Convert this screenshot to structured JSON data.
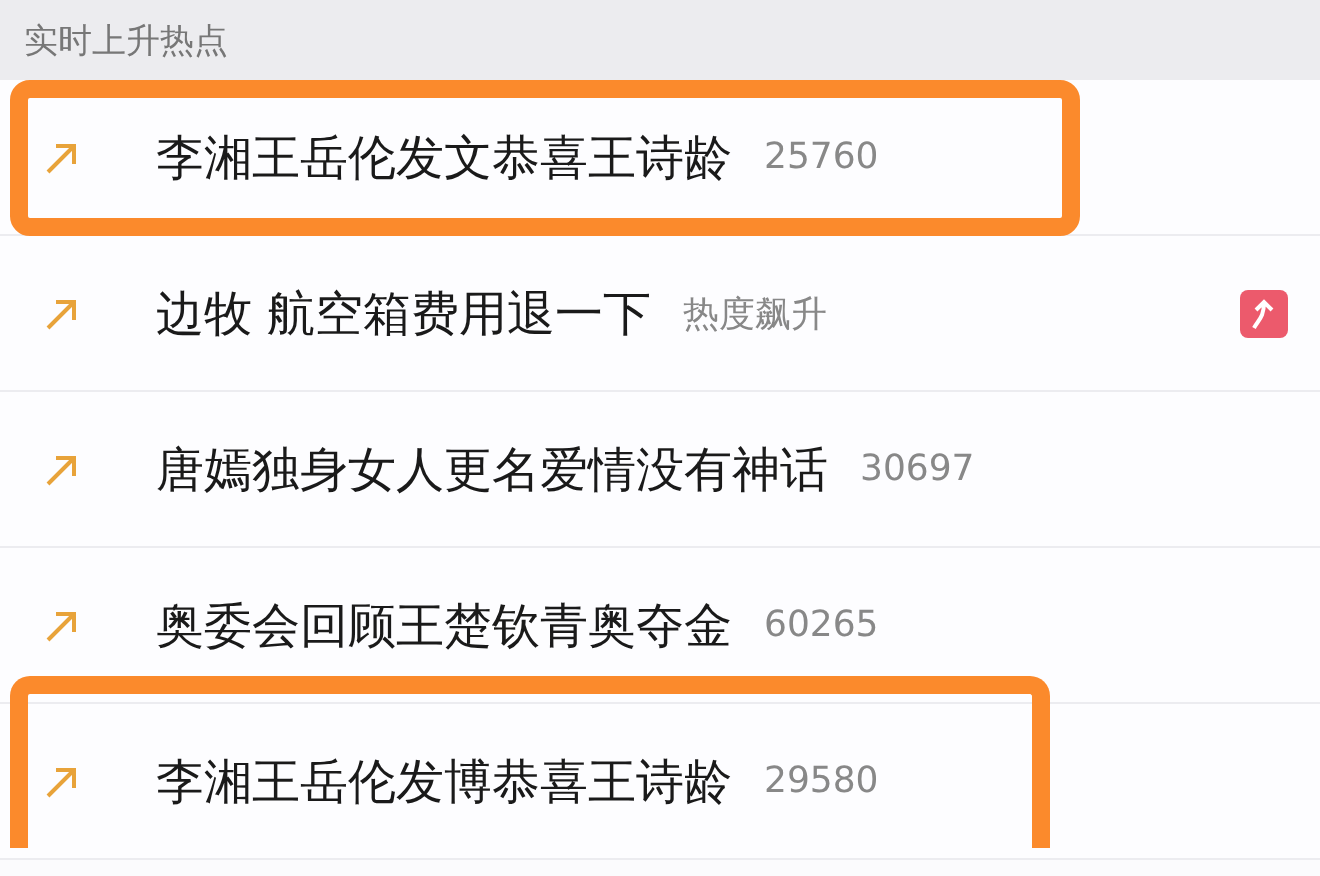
{
  "section_title": "实时上升热点",
  "items": [
    {
      "title": "李湘王岳伦发文恭喜王诗龄",
      "heat": "25760",
      "rising_badge": false,
      "highlighted": true
    },
    {
      "title": "边牧 航空箱费用退一下",
      "heat": "热度飙升",
      "rising_badge": true,
      "highlighted": false
    },
    {
      "title": "唐嫣独身女人更名爱情没有神话",
      "heat": "30697",
      "rising_badge": false,
      "highlighted": false
    },
    {
      "title": "奥委会回顾王楚钦青奥夺金",
      "heat": "60265",
      "rising_badge": false,
      "highlighted": false
    },
    {
      "title": "李湘王岳伦发博恭喜王诗龄",
      "heat": "29580",
      "rising_badge": false,
      "highlighted": true
    }
  ]
}
